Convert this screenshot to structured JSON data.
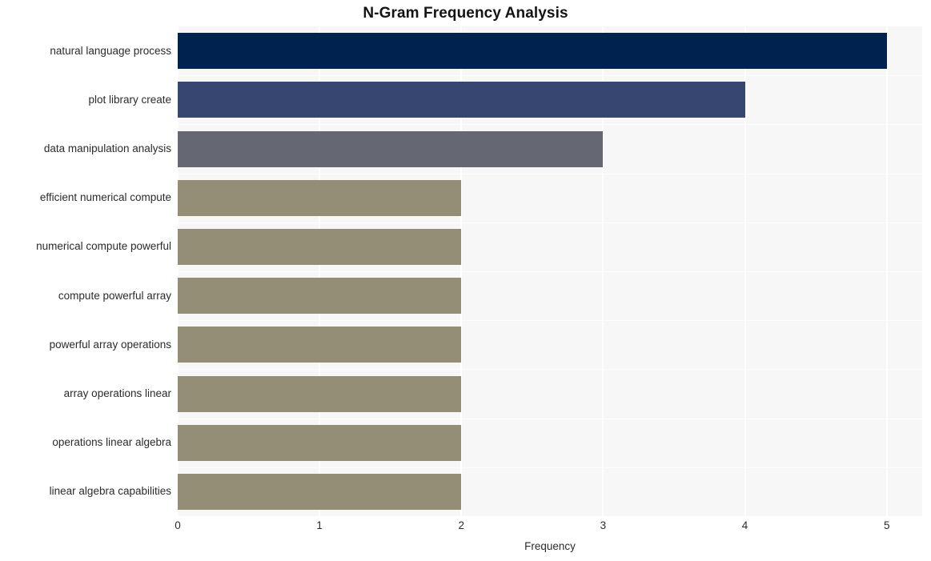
{
  "chart_data": {
    "type": "bar",
    "orientation": "horizontal",
    "title": "N-Gram Frequency Analysis",
    "xlabel": "Frequency",
    "ylabel": "",
    "xlim": [
      0,
      5.25
    ],
    "xticks": [
      0,
      1,
      2,
      3,
      4,
      5
    ],
    "xtick_labels": [
      "0",
      "1",
      "2",
      "3",
      "4",
      "5"
    ],
    "grid": true,
    "legend": "none",
    "categories": [
      "natural language process",
      "plot library create",
      "data manipulation analysis",
      "efficient numerical compute",
      "numerical compute powerful",
      "compute powerful array",
      "powerful array operations",
      "array operations linear",
      "operations linear algebra",
      "linear algebra capabilities"
    ],
    "values": [
      5,
      4,
      3,
      2,
      2,
      2,
      2,
      2,
      2,
      2
    ],
    "bar_colors": [
      "#00224e",
      "#374670",
      "#656872",
      "#948e77",
      "#948e77",
      "#948e77",
      "#948e77",
      "#948e77",
      "#948e77",
      "#948e77"
    ]
  },
  "style": {
    "plot_background": "#f7f7f8",
    "figure_background": "#ffffff",
    "gridline_color": "#ffffff",
    "text_color": "#2b2b2b",
    "title_color": "#141414"
  }
}
